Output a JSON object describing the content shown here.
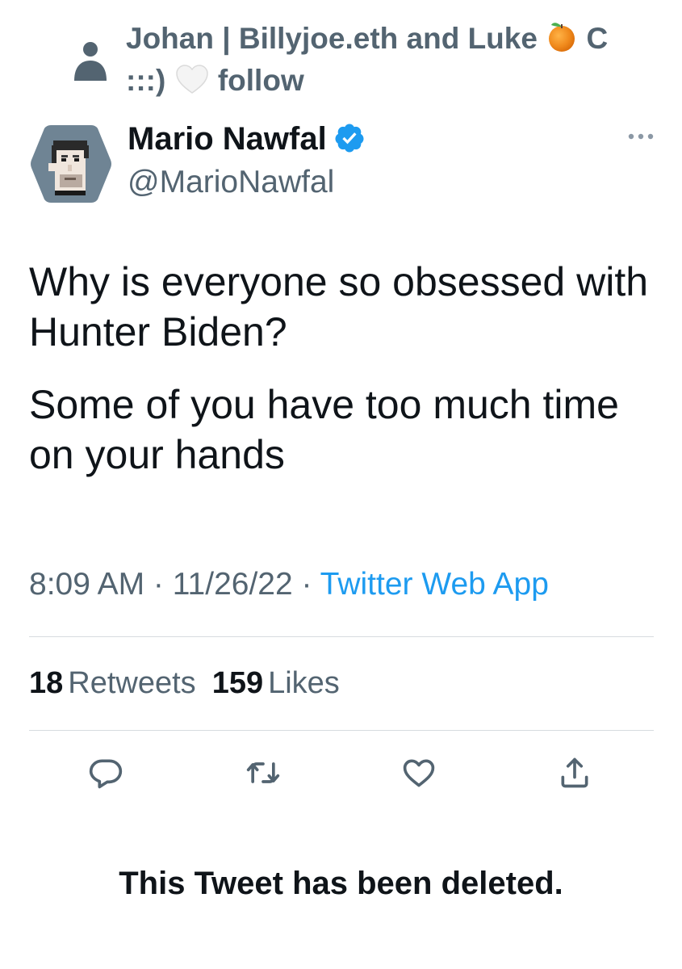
{
  "social_context": {
    "text_before": "Johan | Billyjoe.eth and Luke ",
    "text_middle": " C :::) ",
    "text_after": " follow",
    "icon": "person-icon",
    "emojis": [
      "tangerine-emoji",
      "white-heart-emoji"
    ]
  },
  "author": {
    "display_name": "Mario Nawfal",
    "handle": "@MarioNawfal",
    "verified": true,
    "verified_color": "#1d9bf0"
  },
  "tweet": {
    "paragraphs": [
      "Why is everyone so obsessed with Hunter Biden?",
      "Some of you have too much time on your hands"
    ]
  },
  "meta": {
    "time": "8:09 AM",
    "separator": " · ",
    "date": "11/26/22",
    "source": "Twitter Web App",
    "source_color": "#1d9bf0"
  },
  "stats": {
    "retweets_count": "18",
    "retweets_label": "Retweets",
    "likes_count": "159",
    "likes_label": "Likes"
  },
  "actions": [
    {
      "name": "reply-icon"
    },
    {
      "name": "retweet-icon"
    },
    {
      "name": "like-icon"
    },
    {
      "name": "share-icon"
    }
  ],
  "notice": "This Tweet has been deleted."
}
